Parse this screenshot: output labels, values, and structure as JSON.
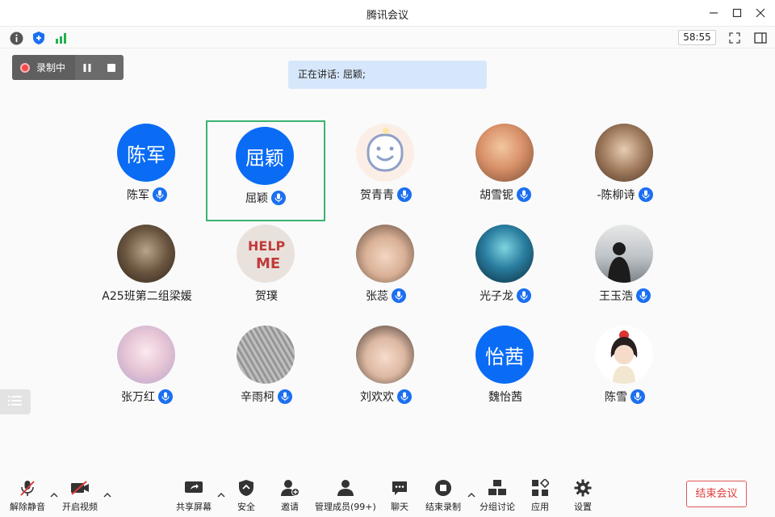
{
  "window": {
    "title": "腾讯会议"
  },
  "toolbar": {
    "timer": "58:55"
  },
  "recording": {
    "label": "录制中"
  },
  "speaking": {
    "text": "正在讲话: 屈颖;"
  },
  "participants": [
    {
      "name": "陈军",
      "avatar_text": "陈军"
    },
    {
      "name": "屈颖",
      "avatar_text": "屈颖",
      "active": true
    },
    {
      "name": "贺青青",
      "avatar_icon": "smiley-face-icon"
    },
    {
      "name": "胡雪铌",
      "avatar_icon": "cat-photo"
    },
    {
      "name": "-陈柳诗",
      "avatar_icon": "portrait-photo"
    },
    {
      "name": "A25班第二组梁媛",
      "avatar_icon": "portrait-photo"
    },
    {
      "name": "贺璞",
      "avatar_icon": "help-me-photo"
    },
    {
      "name": "张蕊",
      "avatar_icon": "child-photo"
    },
    {
      "name": "光子龙",
      "avatar_icon": "jellyfish-photo"
    },
    {
      "name": "王玉浩",
      "avatar_icon": "silhouette-photo"
    },
    {
      "name": "张万红",
      "avatar_icon": "anime-girl-photo"
    },
    {
      "name": "辛雨柯",
      "avatar_icon": "gray-texture-photo"
    },
    {
      "name": "刘欢欢",
      "avatar_icon": "child-photo"
    },
    {
      "name": "魏怡茜",
      "avatar_text": "怡茜"
    },
    {
      "name": "陈雪",
      "avatar_icon": "cartoon-girl-photo"
    }
  ],
  "bottom": {
    "unmute": "解除静音",
    "video": "开启视频",
    "share": "共享屏幕",
    "security": "安全",
    "invite": "邀请",
    "members": "管理成员(99+)",
    "chat": "聊天",
    "stop_record": "结束录制",
    "breakout": "分组讨论",
    "apps": "应用",
    "settings": "设置",
    "end": "结束会议"
  },
  "colors": {
    "accent": "#0a6cf5",
    "active_border": "#3cb371",
    "end_red": "#e03b3b"
  }
}
